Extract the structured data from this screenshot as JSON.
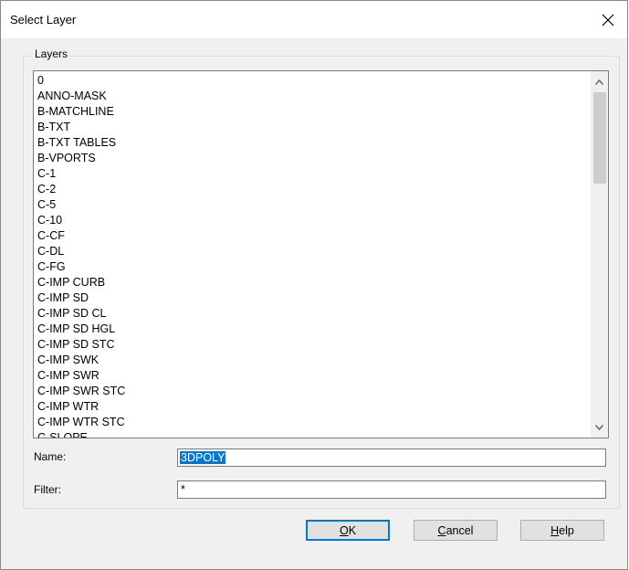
{
  "window": {
    "title": "Select Layer"
  },
  "layers_group": {
    "label": "Layers",
    "items": [
      "0",
      "ANNO-MASK",
      "B-MATCHLINE",
      "B-TXT",
      "B-TXT TABLES",
      "B-VPORTS",
      "C-1",
      "C-2",
      "C-5",
      "C-10",
      "C-CF",
      "C-DL",
      "C-FG",
      "C-IMP CURB",
      "C-IMP SD",
      "C-IMP SD CL",
      "C-IMP SD HGL",
      "C-IMP SD STC",
      "C-IMP SWK",
      "C-IMP SWR",
      "C-IMP SWR STC",
      "C-IMP WTR",
      "C-IMP WTR STC",
      "C-SLOPE"
    ]
  },
  "name_field": {
    "label": "Name:",
    "value": "3DPOLY"
  },
  "filter_field": {
    "label": "Filter:",
    "value": "*"
  },
  "buttons": {
    "ok": {
      "accel": "O",
      "rest": "K"
    },
    "cancel": {
      "accel": "C",
      "rest": "ancel"
    },
    "help": {
      "accel": "H",
      "rest": "elp"
    }
  },
  "icons": {
    "close": "close-icon",
    "scroll_up": "chevron-up-icon",
    "scroll_down": "chevron-down-icon"
  }
}
